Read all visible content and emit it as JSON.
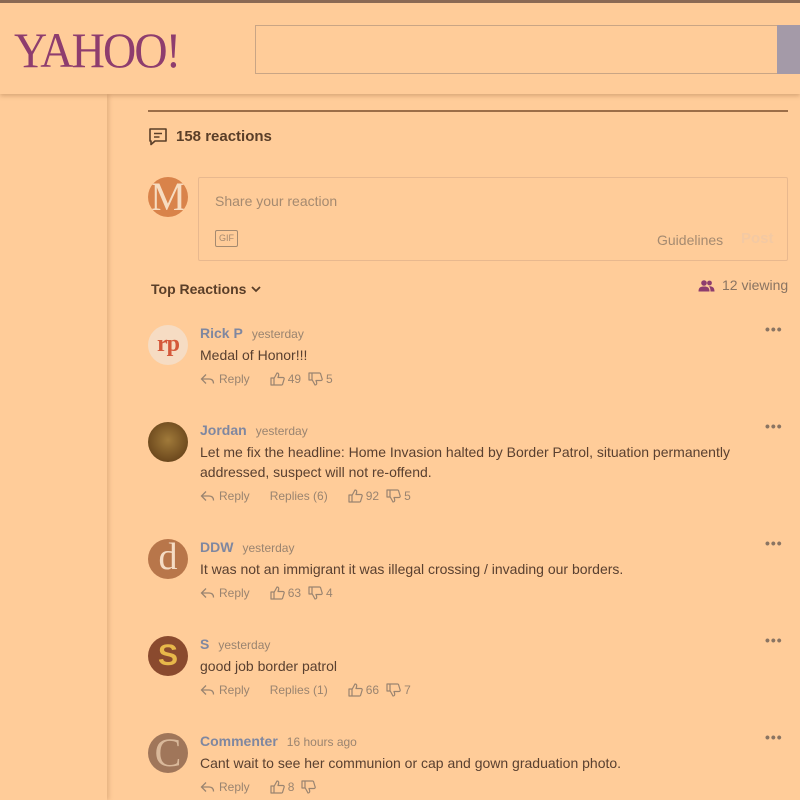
{
  "header": {
    "logo": "YAHOO!",
    "search": {
      "value": "",
      "placeholder": ""
    }
  },
  "reactions": {
    "count_label": "158 reactions"
  },
  "composer": {
    "avatar_letter": "M",
    "placeholder": "Share your reaction",
    "gif_label": "GIF",
    "guidelines_label": "Guidelines",
    "post_label": "Post"
  },
  "sort": {
    "label": "Top Reactions"
  },
  "viewing": {
    "label": "12 viewing"
  },
  "more_label": "•••",
  "comments": [
    {
      "name": "Rick P",
      "time": "yesterday",
      "text": "Medal of Honor!!!",
      "avatar": "rp",
      "reply": "Reply",
      "replies": "",
      "up": "49",
      "down": "5"
    },
    {
      "name": "Jordan",
      "time": "yesterday",
      "text": "Let me fix the headline: Home Invasion halted by Border Patrol, situation permanently addressed, suspect will not re-offend.",
      "avatar": "",
      "reply": "Reply",
      "replies": "Replies (6)",
      "up": "92",
      "down": "5"
    },
    {
      "name": "DDW",
      "time": "yesterday",
      "text": "It was not an immigrant it was illegal crossing / invading our borders.",
      "avatar": "d",
      "reply": "Reply",
      "replies": "",
      "up": "63",
      "down": "4"
    },
    {
      "name": "S",
      "time": "yesterday",
      "text": "good job border patrol",
      "avatar": "S",
      "reply": "Reply",
      "replies": "Replies (1)",
      "up": "66",
      "down": "7"
    },
    {
      "name": "Commenter",
      "time": "16 hours ago",
      "text": "Cant wait to see her communion or cap and gown graduation photo.",
      "avatar": "C",
      "reply": "Reply",
      "replies": "",
      "up": "8",
      "down": ""
    }
  ]
}
